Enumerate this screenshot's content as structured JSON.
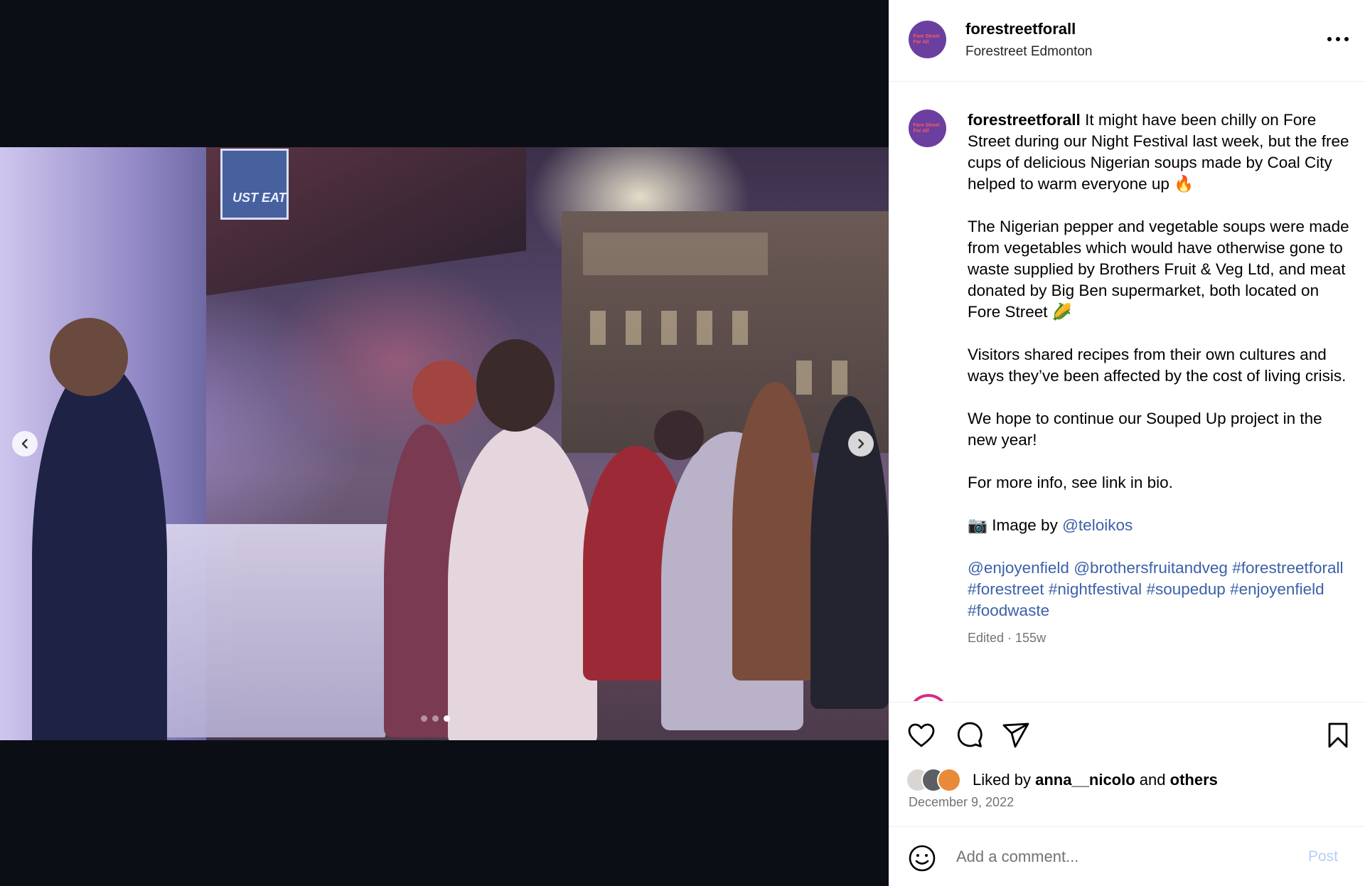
{
  "accent_link": "#3b61a8",
  "header": {
    "username": "forestreetforall",
    "location": "Forestreet Edmonton",
    "avatar_text": "Fore Street For All",
    "more_icon": "more-horizontal-icon"
  },
  "media": {
    "sign_text": "UST EAT",
    "prev_icon": "chevron-left-icon",
    "next_icon": "chevron-right-icon",
    "slide_count": 3,
    "active_slide": 3
  },
  "caption": {
    "username": "forestreetforall",
    "p1": "It might have been chilly on Fore Street during our Night Festival last week, but the free cups of delicious Nigerian soups made by Coal City helped to warm everyone up 🔥",
    "p2": "The Nigerian pepper and vegetable soups were made from vegetables which would have otherwise gone to waste supplied by Brothers Fruit & Veg Ltd, and meat donated by Big Ben supermarket, both located on Fore Street 🌽",
    "p3": "Visitors shared recipes from their own cultures and ways they’ve been affected by the cost of living crisis.",
    "p4": "We hope to continue our Souped Up project in the new year!",
    "p5": "For more info, see link in bio.",
    "photo_prefix": "📷 Image by",
    "photo_credit": "@teloikos",
    "mention1": "@enjoyenfield",
    "mention2": "@brothersfruitandveg",
    "tag1": "#forestreetforall",
    "tag2": "#forestreet",
    "tag3": "#nightfestival",
    "tag4": "#soupedup",
    "tag5": "#enjoyenfield",
    "tag6": "#foodwaste",
    "edited": "Edited · 155w"
  },
  "actions": {
    "like_icon": "heart-icon",
    "comment_icon": "comment-icon",
    "share_icon": "send-icon",
    "save_icon": "bookmark-icon",
    "liked_prefix": "Liked by",
    "liked_user": "anna__nicolo",
    "liked_and": "and",
    "liked_others": "others",
    "date": "December 9, 2022"
  },
  "comment": {
    "placeholder": "Add a comment...",
    "post_label": "Post",
    "emoji_icon": "smiley-icon"
  }
}
